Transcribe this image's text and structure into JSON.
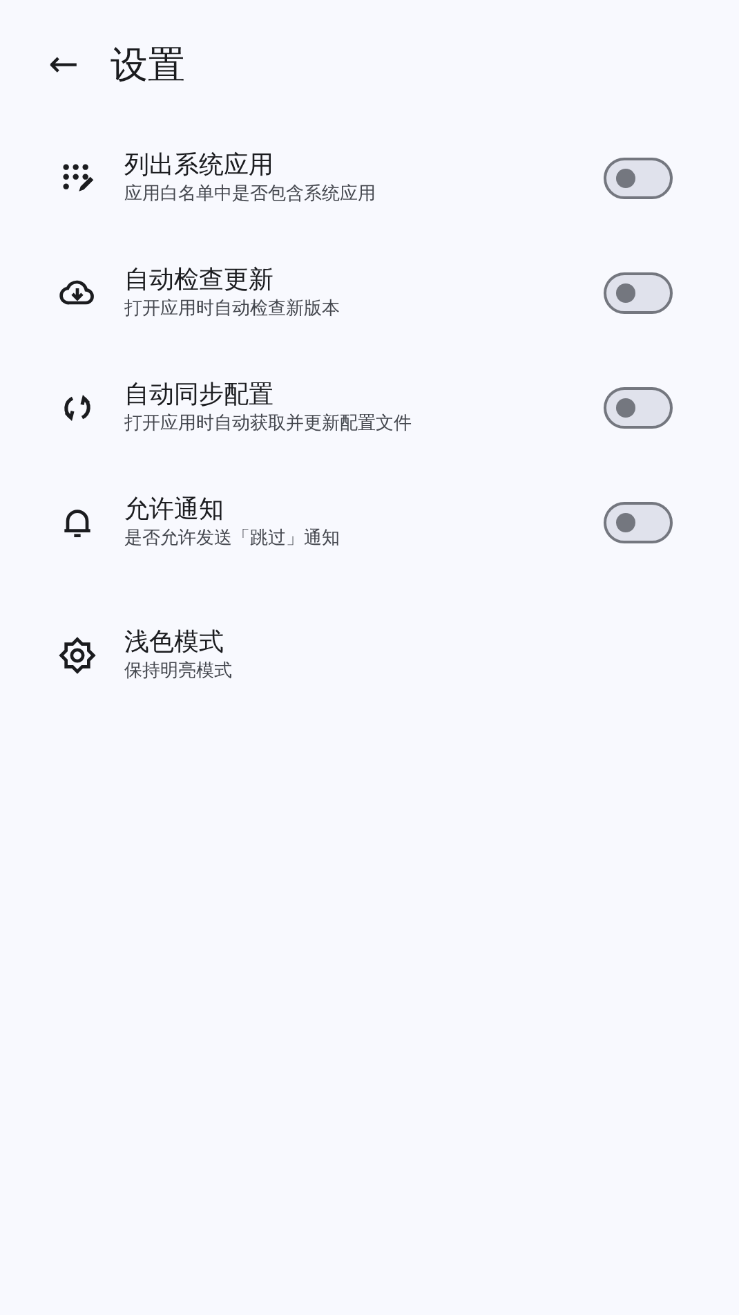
{
  "app_bar": {
    "back": "←",
    "title": "设置"
  },
  "settings": [
    {
      "kind": "switch",
      "title": "列出系统应用",
      "subtitle": "应用白名单中是否包含系统应用",
      "on": false
    },
    {
      "kind": "switch",
      "title": "自动检查更新",
      "subtitle": "打开应用时自动检查新版本",
      "on": false
    },
    {
      "kind": "switch",
      "title": "自动同步配置",
      "subtitle": "打开应用时自动获取并更新配置文件",
      "on": false
    },
    {
      "kind": "switch",
      "title": "允许通知",
      "subtitle": "是否允许发送「跳过」通知",
      "on": false
    },
    {
      "kind": "plain",
      "title": "浅色模式",
      "subtitle": "保持明亮模式"
    }
  ]
}
